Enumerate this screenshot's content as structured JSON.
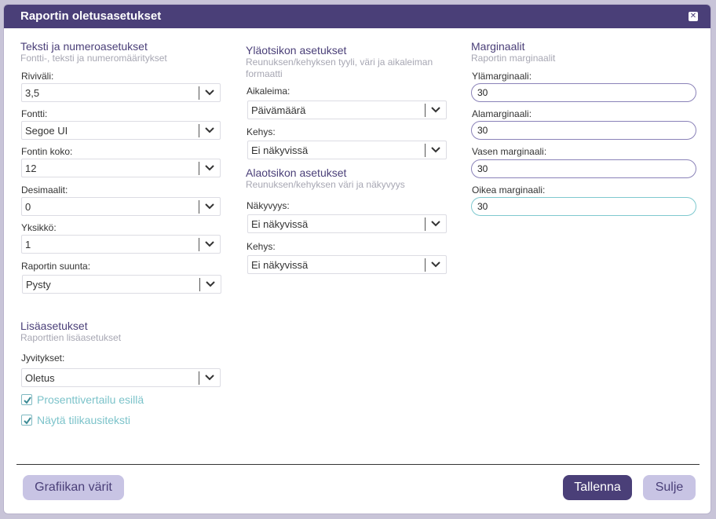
{
  "dialog": {
    "title": "Raportin oletusasetukset",
    "close_icon": "close-icon"
  },
  "text_settings": {
    "heading": "Teksti ja numeroasetukset",
    "subheading": "Fontti-, teksti ja numeromääritykset",
    "fields": [
      {
        "label": "Riviväli:",
        "value": "3,5"
      },
      {
        "label": "Fontti:",
        "value": "Segoe UI"
      },
      {
        "label": "Fontin koko:",
        "value": "12"
      },
      {
        "label": "Desimaalit:",
        "value": "0"
      },
      {
        "label": "Yksikkö:",
        "value": "1"
      },
      {
        "label": "Raportin suunta:",
        "value": "Pysty"
      }
    ]
  },
  "header_settings": {
    "heading": "Yläotsikon asetukset",
    "subheading": "Reunuksen/kehyksen tyyli, väri ja aikaleiman formaatti",
    "fields": [
      {
        "label": "Aikaleima:",
        "value": "Päivämäärä"
      },
      {
        "label": "Kehys:",
        "value": "Ei näkyvissä"
      }
    ]
  },
  "footer_settings": {
    "heading": "Alaotsikon asetukset",
    "subheading": "Reunuksen/kehyksen väri ja näkyvyys",
    "fields": [
      {
        "label": "Näkyvyys:",
        "value": "Ei näkyvissä"
      },
      {
        "label": "Kehys:",
        "value": "Ei näkyvissä"
      }
    ]
  },
  "margins": {
    "heading": "Marginaalit",
    "subheading": "Raportin marginaalit",
    "fields": [
      {
        "label": "Ylämarginaali:",
        "value": "30"
      },
      {
        "label": "Alamarginaali:",
        "value": "30"
      },
      {
        "label": "Vasen marginaali:",
        "value": "30"
      },
      {
        "label": "Oikea marginaali:",
        "value": "30"
      }
    ]
  },
  "extra": {
    "heading": "Lisäasetukset",
    "subheading": "Raporttien lisäasetukset",
    "field": {
      "label": "Jyvitykset:",
      "value": "Oletus"
    },
    "checkboxes": [
      {
        "label": "Prosenttivertailu esillä",
        "checked": true
      },
      {
        "label": "Näytä tilikausiteksti",
        "checked": true
      }
    ]
  },
  "buttons": {
    "colors": "Grafiikan värit",
    "save": "Tallenna",
    "close": "Sulje"
  },
  "colors": {
    "accent": "#4a3f78",
    "checkbox_label": "#7cc3ca",
    "light_button": "#c8c4e4"
  }
}
